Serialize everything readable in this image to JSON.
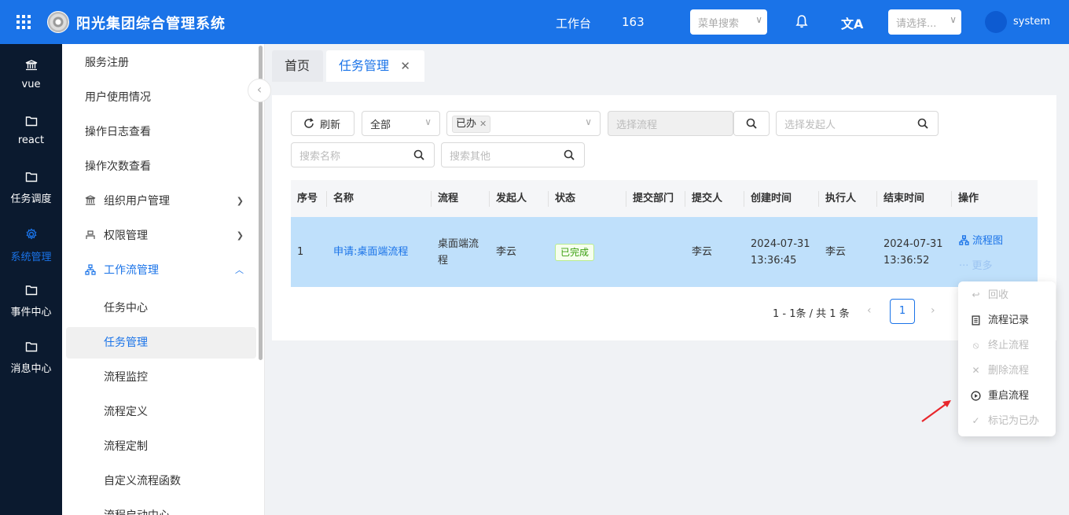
{
  "header": {
    "app_title": "阳光集团综合管理系统",
    "workbench": "工作台",
    "count": "163",
    "menu_search_placeholder": "菜单搜索",
    "select_placeholder": "请选择...",
    "username": "system",
    "brand_color": "#1a73e8"
  },
  "leftnav": {
    "items": [
      {
        "label": "vue",
        "icon": "bank-icon"
      },
      {
        "label": "react",
        "icon": "folder-icon"
      },
      {
        "label": "任务调度",
        "icon": "folder-icon"
      },
      {
        "label": "系统管理",
        "icon": "gear-icon",
        "active": true
      },
      {
        "label": "事件中心",
        "icon": "folder-icon"
      },
      {
        "label": "消息中心",
        "icon": "folder-icon"
      }
    ]
  },
  "subnav": {
    "items": [
      "服务注册",
      "用户使用情况",
      "操作日志查看",
      "操作次数查看"
    ],
    "group_org": "组织用户管理",
    "group_perm": "权限管理",
    "group_workflow": "工作流管理",
    "workflow_children": [
      "任务中心",
      "任务管理",
      "流程监控",
      "流程定义",
      "流程定制",
      "自定义流程函数",
      "流程启动中心"
    ]
  },
  "tabs": {
    "home": "首页",
    "active": "任务管理"
  },
  "filters": {
    "refresh": "刷新",
    "scope": "全部",
    "status_tag": "已办",
    "process_placeholder": "选择流程",
    "initiator_placeholder": "选择发起人",
    "name_placeholder": "搜索名称",
    "other_placeholder": "搜索其他"
  },
  "table": {
    "headers": [
      "序号",
      "名称",
      "流程",
      "发起人",
      "状态",
      "提交部门",
      "提交人",
      "创建时间",
      "执行人",
      "结束时间",
      "操作"
    ],
    "row": {
      "index": "1",
      "name": "申请:桌面端流程",
      "process": "桌面端流程",
      "initiator": "李云",
      "status": "已完成",
      "department": "",
      "submitter": "李云",
      "created": "2024-07-31 13:36:45",
      "executor": "李云",
      "ended": "2024-07-31 13:36:52",
      "op_flow": "流程图",
      "op_more": "更多"
    }
  },
  "pagination": {
    "summary": "1 - 1条 / 共 1 条",
    "page": "1"
  },
  "dropdown": {
    "items": [
      {
        "label": "回收",
        "icon": "return-icon",
        "disabled": true
      },
      {
        "label": "流程记录",
        "icon": "record-icon",
        "disabled": false
      },
      {
        "label": "终止流程",
        "icon": "stop-icon",
        "disabled": true
      },
      {
        "label": "删除流程",
        "icon": "close-icon",
        "disabled": true
      },
      {
        "label": "重启流程",
        "icon": "restart-icon",
        "disabled": false
      },
      {
        "label": "标记为已办",
        "icon": "check-icon",
        "disabled": true
      }
    ]
  }
}
